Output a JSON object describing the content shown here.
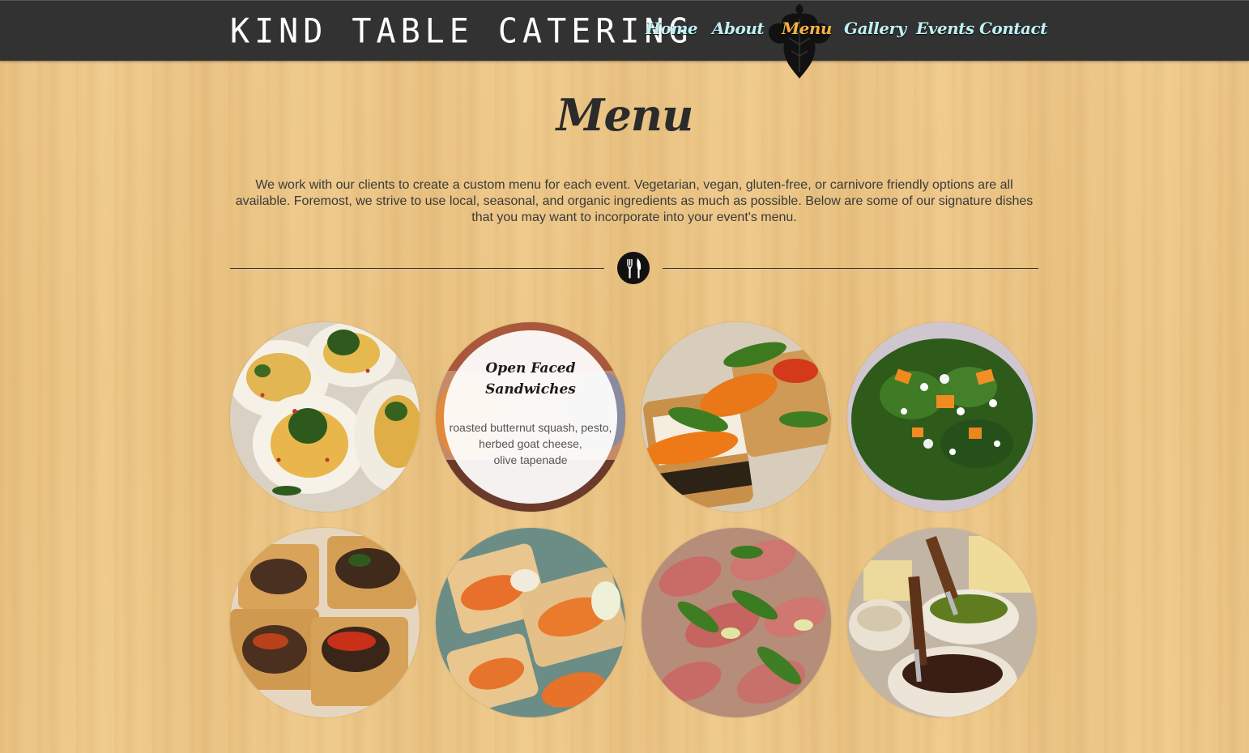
{
  "header": {
    "brand": "KIND TABLE CATERING",
    "nav": [
      {
        "label": "Home",
        "active": false
      },
      {
        "label": "About",
        "active": false
      },
      {
        "label": "Menu",
        "active": true
      },
      {
        "label": "Gallery",
        "active": false
      },
      {
        "label": "Events",
        "active": false
      },
      {
        "label": "Contact",
        "active": false
      }
    ],
    "active_icon": "fig-leaf-icon"
  },
  "main": {
    "title": "Menu",
    "intro": "We work with our clients to create a custom menu for each event. Vegetarian, vegan, gluten-free, or carnivore friendly options are all available. Foremost, we strive to use local, seasonal, and organic ingredients as much as possible. Below are some of our signature dishes that you may want to incorporate into your event's menu.",
    "divider_icon": "utensils-icon"
  },
  "dishes": [
    {
      "image": "deviled-eggs-photo"
    },
    {
      "image": "open-faced-sandwich-photo",
      "hover": true,
      "title": "Open Faced Sandwiches",
      "description_lines": [
        "roasted butternut squash, pesto,",
        "herbed goat cheese,",
        "olive tapenade"
      ]
    },
    {
      "image": "crostini-photo"
    },
    {
      "image": "arugula-salad-photo"
    },
    {
      "image": "mushroom-tartlets-photo"
    },
    {
      "image": "squash-flatbread-photo"
    },
    {
      "image": "prosciutto-rolls-photo"
    },
    {
      "image": "dips-and-cheese-photo"
    }
  ],
  "colors": {
    "navbar": "#323232",
    "nav_link": "#bff0f4",
    "nav_active": "#f4b142",
    "wood": "#efc98c",
    "text": "#3a3a3a"
  }
}
